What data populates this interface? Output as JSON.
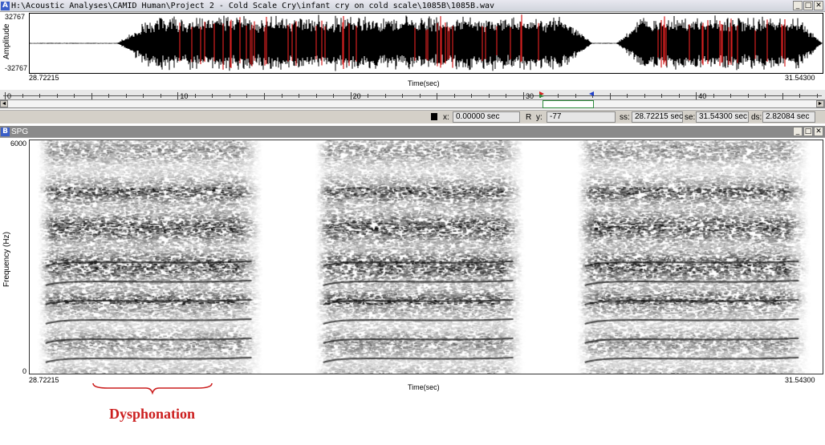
{
  "window_a": {
    "badge": "A",
    "title": "H:\\Acoustic Analyses\\CAMID Human\\Project 2 - Cold Scale Cry\\infant cry on cold scale\\1085B\\1085B.wav",
    "min": "_",
    "max": "□",
    "close": "✕"
  },
  "waveform": {
    "ylabel": "Amplitude",
    "y_top": "32767",
    "y_bottom": "-32767",
    "x_start": "28.72215",
    "x_end": "31.54300",
    "xlabel": "Time(sec)",
    "colors": {
      "trace": "#000000",
      "marker": "#d42020"
    },
    "segments": [
      [
        0.11,
        0.48
      ],
      [
        0.41,
        0.71
      ],
      [
        0.74,
        1.0
      ]
    ]
  },
  "ruler": {
    "labels": [
      "0",
      "10",
      "20",
      "30",
      "40"
    ],
    "left_arrow": "◄",
    "right_arrow": "►"
  },
  "status": {
    "x_label": "x:",
    "x_value": "0.00000 sec",
    "r_label": "R",
    "y_label": "y:",
    "y_value": "-77",
    "ss_label": "ss:",
    "ss_value": "28.72215 sec",
    "se_label": "se:",
    "se_value": "31.54300 sec",
    "ds_label": "ds:",
    "ds_value": "2.82084 sec"
  },
  "window_b": {
    "badge": "B",
    "title": "SPG",
    "min": "_",
    "max": "□",
    "close": "✕"
  },
  "spectrogram": {
    "ylabel": "Frequency (Hz)",
    "y_top": "6000",
    "y_bottom": "0",
    "x_start": "28.72215",
    "x_end": "31.54300",
    "xlabel": "Time(sec)"
  },
  "annotation": {
    "label": "Dysphonation",
    "color": "#cc1f1f"
  }
}
